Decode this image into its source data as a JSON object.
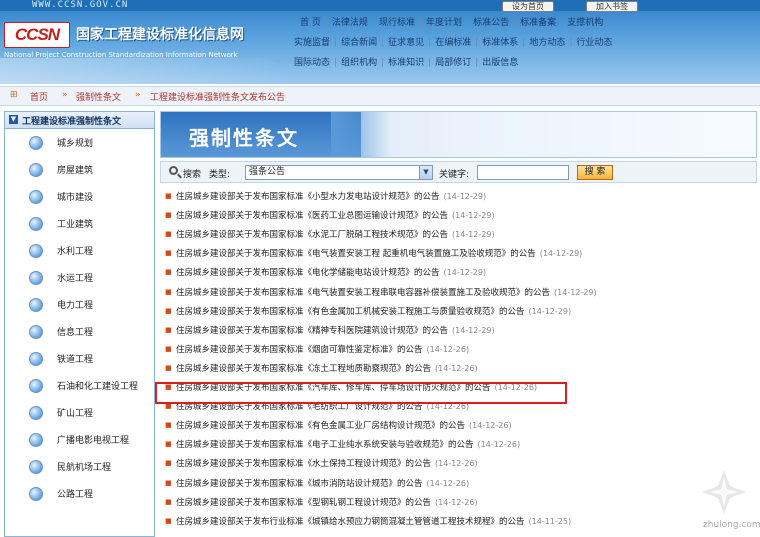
{
  "header": {
    "url": "WWW.CCSN.GOV.CN",
    "set_home": "设为首页",
    "add_fav": "加入书签",
    "logo": "CCSN",
    "title": "国家工程建设标准化信息网",
    "subtitle": "National Project Construction Standardization Information Network",
    "nav_rows": [
      [
        "首 页",
        "法律法规",
        "现行标准",
        "年度计划",
        "标准公告",
        "标准备案",
        "支撑机构"
      ],
      [
        "实施监督",
        "综合新闻",
        "征求意见",
        "在编标准",
        "标准体系",
        "地方动态",
        "行业动态"
      ],
      [
        "国际动态",
        "组织机构",
        "标准知识",
        "局部修订",
        "出版信息"
      ]
    ]
  },
  "breadcrumb": {
    "items": [
      "首页",
      "强制性条文",
      "工程建设标准强制性条文发布公告"
    ]
  },
  "sidebar": {
    "heading": "工程建设标准强制性条文",
    "items": [
      "城乡规划",
      "房屋建筑",
      "城市建设",
      "工业建筑",
      "水利工程",
      "水运工程",
      "电力工程",
      "信息工程",
      "铁道工程",
      "石油和化工建设工程",
      "矿山工程",
      "广播电影电视工程",
      "民航机场工程",
      "公路工程"
    ]
  },
  "banner": {
    "title": "强制性条文"
  },
  "search": {
    "label": "搜索",
    "type_label": "类型:",
    "type_value": "强条公告",
    "keyword_label": "关键字:",
    "keyword_value": "",
    "button": "搜 索"
  },
  "list": [
    {
      "title": "住房城乡建设部关于发布国家标准《小型水力发电站设计规范》的公告",
      "date": "(14-12-29)"
    },
    {
      "title": "住房城乡建设部关于发布国家标准《医药工业总图运输设计规范》的公告",
      "date": "(14-12-29)"
    },
    {
      "title": "住房城乡建设部关于发布国家标准《水泥工厂脱硝工程技术规范》的公告",
      "date": "(14-12-29)"
    },
    {
      "title": "住房城乡建设部关于发布国家标准《电气装置安装工程 起重机电气装置施工及验收规范》的公告",
      "date": "(14-12-29)"
    },
    {
      "title": "住房城乡建设部关于发布国家标准《电化学储能电站设计规范》的公告",
      "date": "(14-12-29)"
    },
    {
      "title": "住房城乡建设部关于发布国家标准《电气装置安装工程串联电容器补偿装置施工及验收规范》的公告",
      "date": "(14-12-29)"
    },
    {
      "title": "住房城乡建设部关于发布国家标准《有色金属加工机械安装工程施工与质量验收规范》的公告",
      "date": "(14-12-29)"
    },
    {
      "title": "住房城乡建设部关于发布国家标准《精神专科医院建筑设计规范》的公告",
      "date": "(14-12-29)"
    },
    {
      "title": "住房城乡建设部关于发布国家标准《烟囱可靠性鉴定标准》的公告",
      "date": "(14-12-26)"
    },
    {
      "title": "住房城乡建设部关于发布国家标准《冻土工程地质勘察规范》的公告",
      "date": "(14-12-26)"
    },
    {
      "title": "住房城乡建设部关于发布国家标准《汽车库、修车库、停车场设计防火规范》的公告",
      "date": "(14-12-26)"
    },
    {
      "title": "住房城乡建设部关于发布国家标准《毛纺织工厂设计规范》的公告",
      "date": "(14-12-26)"
    },
    {
      "title": "住房城乡建设部关于发布国家标准《有色金属工业厂房结构设计规范》的公告",
      "date": "(14-12-26)"
    },
    {
      "title": "住房城乡建设部关于发布国家标准《电子工业纯水系统安装与验收规范》的公告",
      "date": "(14-12-26)"
    },
    {
      "title": "住房城乡建设部关于发布国家标准《水土保持工程设计规范》的公告",
      "date": "(14-12-26)"
    },
    {
      "title": "住房城乡建设部关于发布国家标准《城市消防站设计规范》的公告",
      "date": "(14-12-26)"
    },
    {
      "title": "住房城乡建设部关于发布国家标准《型钢轧钢工程设计规范》的公告",
      "date": "(14-12-26)"
    },
    {
      "title": "住房城乡建设部关于发布行业标准《城镇给水预应力钢筒混凝土管管道工程技术规程》的公告",
      "date": "(14-11-25)"
    }
  ],
  "watermark": "zhulong.com",
  "colors": {
    "header_blue": "#2f7fc6",
    "highlight": "#d81e1e",
    "link_red": "#b0322b"
  }
}
